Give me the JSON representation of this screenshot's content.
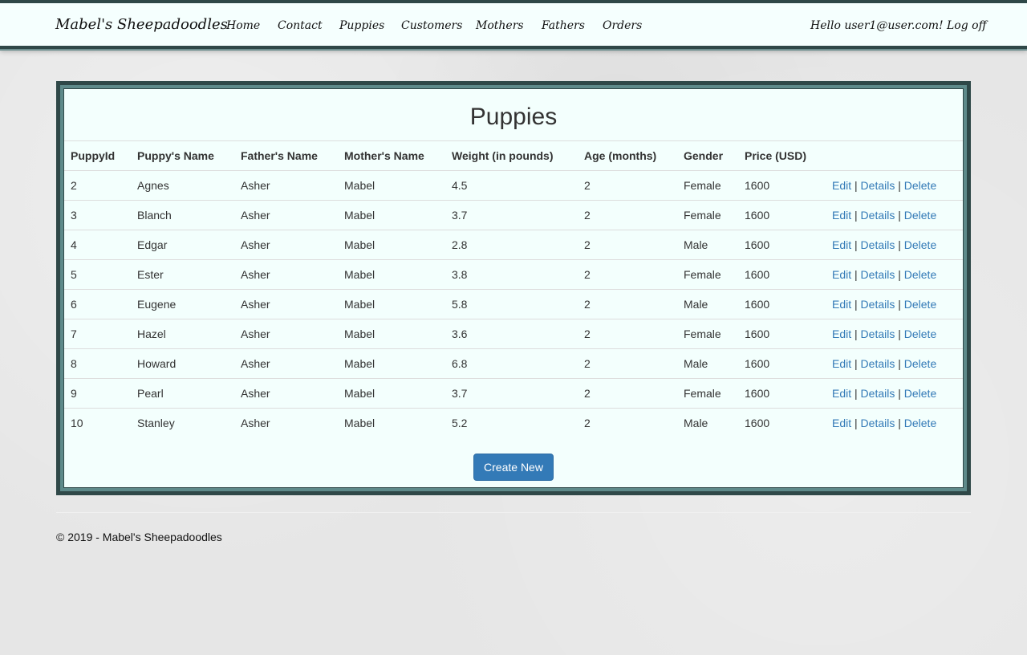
{
  "nav": {
    "brand": "Mabel's Sheepadoodles",
    "links": [
      "Home",
      "Contact",
      "Puppies",
      "Customers",
      "Mothers",
      "Fathers",
      "Orders"
    ],
    "greeting": "Hello user1@user.com!",
    "logoff": "Log off"
  },
  "page": {
    "title": "Puppies",
    "columns": [
      "PuppyId",
      "Puppy's Name",
      "Father's Name",
      "Mother's Name",
      "Weight (in pounds)",
      "Age (months)",
      "Gender",
      "Price (USD)"
    ],
    "rows": [
      [
        "2",
        "Agnes",
        "Asher",
        "Mabel",
        "4.5",
        "2",
        "Female",
        "1600"
      ],
      [
        "3",
        "Blanch",
        "Asher",
        "Mabel",
        "3.7",
        "2",
        "Female",
        "1600"
      ],
      [
        "4",
        "Edgar",
        "Asher",
        "Mabel",
        "2.8",
        "2",
        "Male",
        "1600"
      ],
      [
        "5",
        "Ester",
        "Asher",
        "Mabel",
        "3.8",
        "2",
        "Female",
        "1600"
      ],
      [
        "6",
        "Eugene",
        "Asher",
        "Mabel",
        "5.8",
        "2",
        "Male",
        "1600"
      ],
      [
        "7",
        "Hazel",
        "Asher",
        "Mabel",
        "3.6",
        "2",
        "Female",
        "1600"
      ],
      [
        "8",
        "Howard",
        "Asher",
        "Mabel",
        "6.8",
        "2",
        "Male",
        "1600"
      ],
      [
        "9",
        "Pearl",
        "Asher",
        "Mabel",
        "3.7",
        "2",
        "Female",
        "1600"
      ],
      [
        "10",
        "Stanley",
        "Asher",
        "Mabel",
        "5.2",
        "2",
        "Male",
        "1600"
      ]
    ],
    "row_actions": {
      "edit": "Edit",
      "details": "Details",
      "delete": "Delete",
      "separator": "|"
    },
    "create_button": "Create New"
  },
  "footer": {
    "copyright": "© 2019 - Mabel's Sheepadoodles"
  },
  "colors": {
    "nav_border": "#2f4848",
    "panel_bg": "#f3fffd",
    "link": "#337ab7",
    "button": "#337ab7"
  }
}
